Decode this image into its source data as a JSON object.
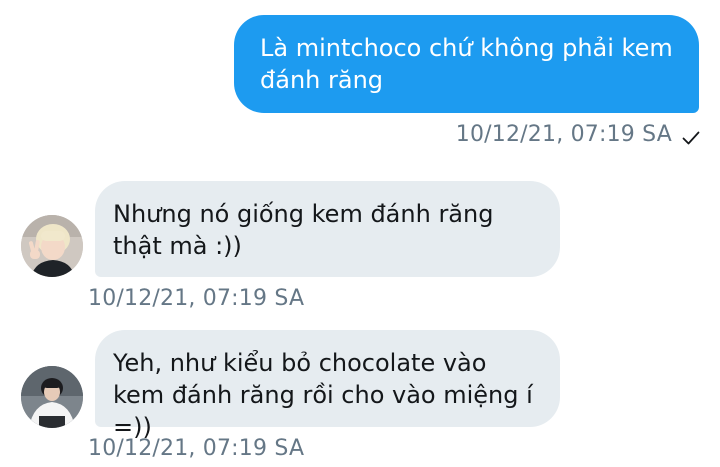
{
  "messages": [
    {
      "direction": "outgoing",
      "text": "Là mintchoco chứ không phải kem đánh răng",
      "timestamp": "10/12/21, 07:19 SA",
      "status_icon": "check-icon"
    },
    {
      "direction": "incoming",
      "text": "Nhưng nó giống kem đánh răng thật mà :))",
      "timestamp": "10/12/21, 07:19 SA"
    },
    {
      "direction": "incoming",
      "text": "Yeh, như kiểu bỏ chocolate vào kem đánh răng rồi cho vào miệng í =))",
      "timestamp": "10/12/21, 07:19 SA"
    }
  ],
  "colors": {
    "outgoing_bubble": "#1d9bf0",
    "incoming_bubble": "#e6ecf0",
    "timestamp": "#657786"
  }
}
